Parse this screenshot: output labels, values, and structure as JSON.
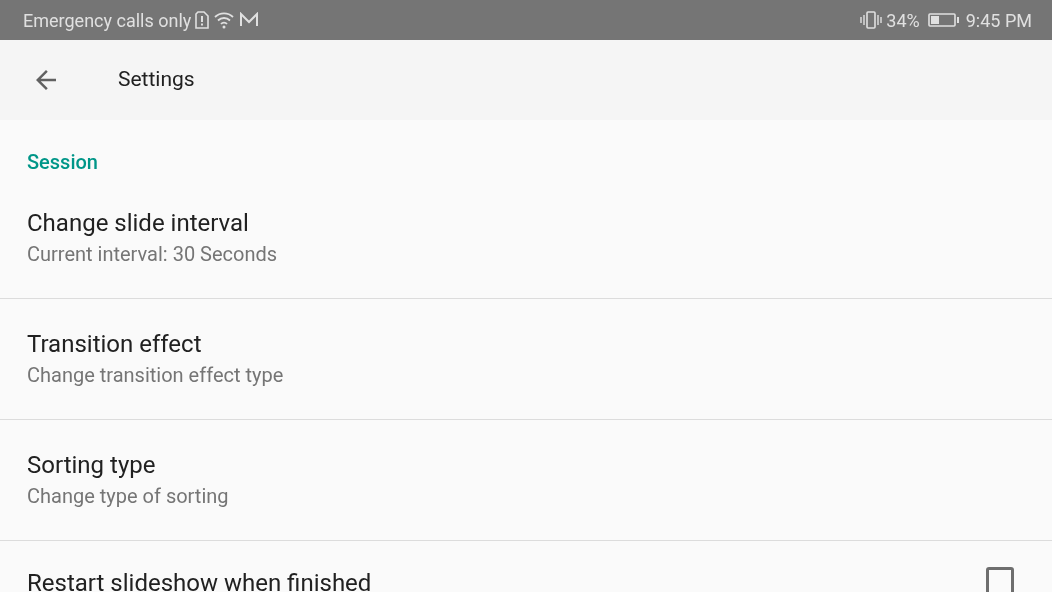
{
  "status_bar": {
    "carrier": "Emergency calls only",
    "battery": "34%",
    "time": "9:45 PM"
  },
  "app_bar": {
    "title": "Settings"
  },
  "section": {
    "title": "Session"
  },
  "items": [
    {
      "kind": "text",
      "title": "Change slide interval",
      "summary": "Current interval: 30 Seconds"
    },
    {
      "kind": "text",
      "title": "Transition effect",
      "summary": "Change transition effect type"
    },
    {
      "kind": "text",
      "title": "Sorting type",
      "summary": "Change type of sorting"
    },
    {
      "kind": "checkbox",
      "title": "Restart slideshow when finished",
      "checked": false
    }
  ]
}
